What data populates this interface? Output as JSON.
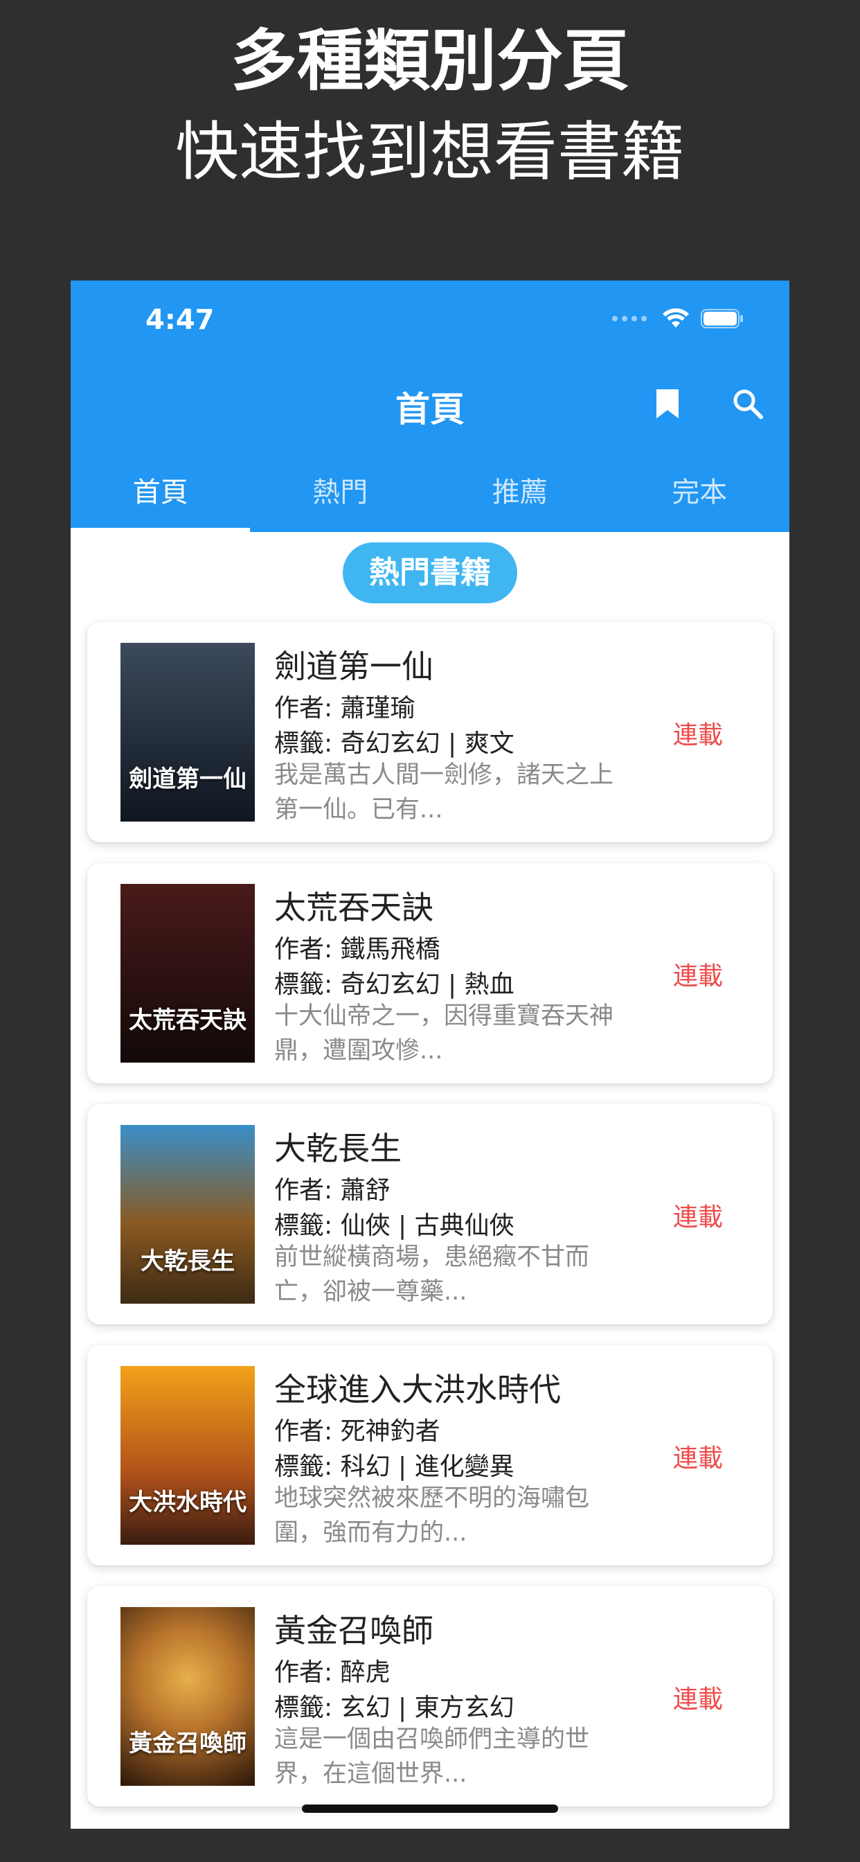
{
  "promo": {
    "line1": "多種類別分頁",
    "line2": "快速找到想看書籍"
  },
  "status_bar": {
    "time": "4:47"
  },
  "appbar": {
    "title": "首頁",
    "icons": [
      "bookmark-icon",
      "search-icon"
    ]
  },
  "tabs": [
    {
      "label": "首頁",
      "active": true
    },
    {
      "label": "熱門",
      "active": false
    },
    {
      "label": "推薦",
      "active": false
    },
    {
      "label": "完本",
      "active": false
    }
  ],
  "section_title": "熱門書籍",
  "books": [
    {
      "title": "劍道第一仙",
      "author": "作者: 蕭瑾瑜",
      "tags": "標籤: 奇幻玄幻 | 爽文",
      "desc": "我是萬古人間一劍修，諸天之上第一仙。已有...",
      "status": "連載",
      "cover_text": "劍道第一仙",
      "cover_colors": [
        "#3c4a5c",
        "#0f1620"
      ]
    },
    {
      "title": "太荒吞天訣",
      "author": "作者: 鐵馬飛橋",
      "tags": "標籤: 奇幻玄幻 | 熱血",
      "desc": "十大仙帝之一，因得重寶吞天神鼎，遭圍攻慘...",
      "status": "連載",
      "cover_text": "太荒吞天訣",
      "cover_colors": [
        "#4a1a1a",
        "#120909"
      ]
    },
    {
      "title": "大乾長生",
      "author": "作者: 蕭舒",
      "tags": "標籤: 仙俠 | 古典仙俠",
      "desc": "前世縱橫商場，患絕癥不甘而亡，卻被一尊藥...",
      "status": "連載",
      "cover_text": "大乾長生",
      "cover_colors": [
        "#3a8fc8",
        "#3d2a14"
      ]
    },
    {
      "title": "全球進入大洪水時代",
      "author": "作者: 死神釣者",
      "tags": "標籤: 科幻 | 進化變異",
      "desc": "地球突然被來歷不明的海嘯包圍，強而有力的...",
      "status": "連載",
      "cover_text": "大洪水時代",
      "cover_colors": [
        "#f2a21a",
        "#3a1c10"
      ]
    },
    {
      "title": "黃金召喚師",
      "author": "作者: 醉虎",
      "tags": "標籤: 玄幻 | 東方玄幻",
      "desc": "這是一個由召喚師們主導的世界，在這個世界...",
      "status": "連載",
      "cover_text": "黃金召喚師",
      "cover_colors": [
        "#b8742c",
        "#2a1508"
      ]
    }
  ]
}
